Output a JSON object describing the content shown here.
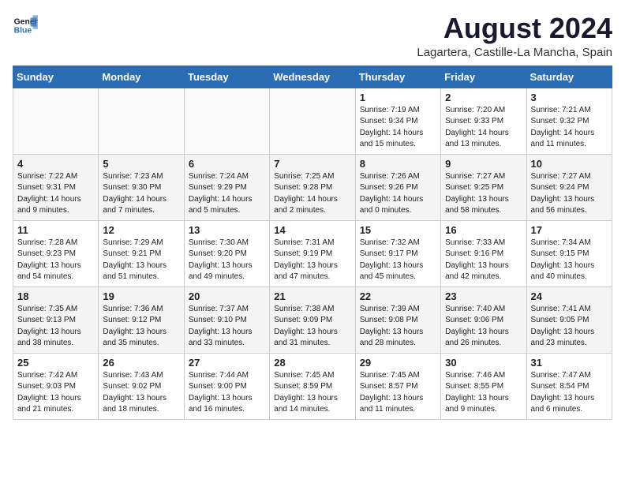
{
  "header": {
    "logo_line1": "General",
    "logo_line2": "Blue",
    "month_year": "August 2024",
    "location": "Lagartera, Castille-La Mancha, Spain"
  },
  "weekdays": [
    "Sunday",
    "Monday",
    "Tuesday",
    "Wednesday",
    "Thursday",
    "Friday",
    "Saturday"
  ],
  "weeks": [
    [
      {
        "day": "",
        "info": ""
      },
      {
        "day": "",
        "info": ""
      },
      {
        "day": "",
        "info": ""
      },
      {
        "day": "",
        "info": ""
      },
      {
        "day": "1",
        "info": "Sunrise: 7:19 AM\nSunset: 9:34 PM\nDaylight: 14 hours\nand 15 minutes."
      },
      {
        "day": "2",
        "info": "Sunrise: 7:20 AM\nSunset: 9:33 PM\nDaylight: 14 hours\nand 13 minutes."
      },
      {
        "day": "3",
        "info": "Sunrise: 7:21 AM\nSunset: 9:32 PM\nDaylight: 14 hours\nand 11 minutes."
      }
    ],
    [
      {
        "day": "4",
        "info": "Sunrise: 7:22 AM\nSunset: 9:31 PM\nDaylight: 14 hours\nand 9 minutes."
      },
      {
        "day": "5",
        "info": "Sunrise: 7:23 AM\nSunset: 9:30 PM\nDaylight: 14 hours\nand 7 minutes."
      },
      {
        "day": "6",
        "info": "Sunrise: 7:24 AM\nSunset: 9:29 PM\nDaylight: 14 hours\nand 5 minutes."
      },
      {
        "day": "7",
        "info": "Sunrise: 7:25 AM\nSunset: 9:28 PM\nDaylight: 14 hours\nand 2 minutes."
      },
      {
        "day": "8",
        "info": "Sunrise: 7:26 AM\nSunset: 9:26 PM\nDaylight: 14 hours\nand 0 minutes."
      },
      {
        "day": "9",
        "info": "Sunrise: 7:27 AM\nSunset: 9:25 PM\nDaylight: 13 hours\nand 58 minutes."
      },
      {
        "day": "10",
        "info": "Sunrise: 7:27 AM\nSunset: 9:24 PM\nDaylight: 13 hours\nand 56 minutes."
      }
    ],
    [
      {
        "day": "11",
        "info": "Sunrise: 7:28 AM\nSunset: 9:23 PM\nDaylight: 13 hours\nand 54 minutes."
      },
      {
        "day": "12",
        "info": "Sunrise: 7:29 AM\nSunset: 9:21 PM\nDaylight: 13 hours\nand 51 minutes."
      },
      {
        "day": "13",
        "info": "Sunrise: 7:30 AM\nSunset: 9:20 PM\nDaylight: 13 hours\nand 49 minutes."
      },
      {
        "day": "14",
        "info": "Sunrise: 7:31 AM\nSunset: 9:19 PM\nDaylight: 13 hours\nand 47 minutes."
      },
      {
        "day": "15",
        "info": "Sunrise: 7:32 AM\nSunset: 9:17 PM\nDaylight: 13 hours\nand 45 minutes."
      },
      {
        "day": "16",
        "info": "Sunrise: 7:33 AM\nSunset: 9:16 PM\nDaylight: 13 hours\nand 42 minutes."
      },
      {
        "day": "17",
        "info": "Sunrise: 7:34 AM\nSunset: 9:15 PM\nDaylight: 13 hours\nand 40 minutes."
      }
    ],
    [
      {
        "day": "18",
        "info": "Sunrise: 7:35 AM\nSunset: 9:13 PM\nDaylight: 13 hours\nand 38 minutes."
      },
      {
        "day": "19",
        "info": "Sunrise: 7:36 AM\nSunset: 9:12 PM\nDaylight: 13 hours\nand 35 minutes."
      },
      {
        "day": "20",
        "info": "Sunrise: 7:37 AM\nSunset: 9:10 PM\nDaylight: 13 hours\nand 33 minutes."
      },
      {
        "day": "21",
        "info": "Sunrise: 7:38 AM\nSunset: 9:09 PM\nDaylight: 13 hours\nand 31 minutes."
      },
      {
        "day": "22",
        "info": "Sunrise: 7:39 AM\nSunset: 9:08 PM\nDaylight: 13 hours\nand 28 minutes."
      },
      {
        "day": "23",
        "info": "Sunrise: 7:40 AM\nSunset: 9:06 PM\nDaylight: 13 hours\nand 26 minutes."
      },
      {
        "day": "24",
        "info": "Sunrise: 7:41 AM\nSunset: 9:05 PM\nDaylight: 13 hours\nand 23 minutes."
      }
    ],
    [
      {
        "day": "25",
        "info": "Sunrise: 7:42 AM\nSunset: 9:03 PM\nDaylight: 13 hours\nand 21 minutes."
      },
      {
        "day": "26",
        "info": "Sunrise: 7:43 AM\nSunset: 9:02 PM\nDaylight: 13 hours\nand 18 minutes."
      },
      {
        "day": "27",
        "info": "Sunrise: 7:44 AM\nSunset: 9:00 PM\nDaylight: 13 hours\nand 16 minutes."
      },
      {
        "day": "28",
        "info": "Sunrise: 7:45 AM\nSunset: 8:59 PM\nDaylight: 13 hours\nand 14 minutes."
      },
      {
        "day": "29",
        "info": "Sunrise: 7:45 AM\nSunset: 8:57 PM\nDaylight: 13 hours\nand 11 minutes."
      },
      {
        "day": "30",
        "info": "Sunrise: 7:46 AM\nSunset: 8:55 PM\nDaylight: 13 hours\nand 9 minutes."
      },
      {
        "day": "31",
        "info": "Sunrise: 7:47 AM\nSunset: 8:54 PM\nDaylight: 13 hours\nand 6 minutes."
      }
    ]
  ]
}
